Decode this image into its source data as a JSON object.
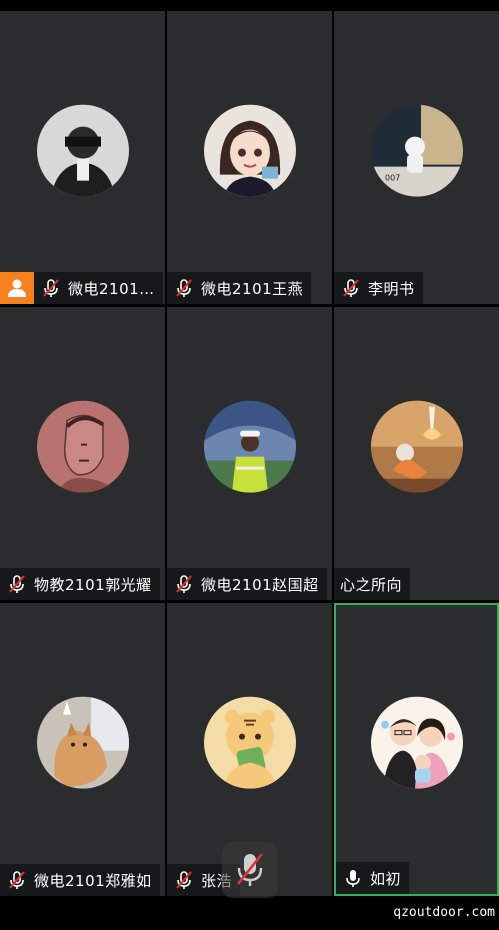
{
  "participants": [
    {
      "name": "微电2101…",
      "mic": "muted",
      "host": true,
      "avatar": "avatar-icon-person-camera",
      "color": "#cfcfcf"
    },
    {
      "name": "微电2101王燕",
      "mic": "muted",
      "host": false,
      "avatar": "avatar-icon-anime-girl",
      "color": "#e8dcd0"
    },
    {
      "name": "李明书",
      "mic": "muted",
      "host": false,
      "avatar": "avatar-icon-astronaut-figure",
      "color": "#2a3b4a"
    },
    {
      "name": "物教2101郭光耀",
      "mic": "muted",
      "host": false,
      "avatar": "avatar-icon-sketch-portrait",
      "color": "#b37370"
    },
    {
      "name": "微电2101赵国超",
      "mic": "muted",
      "host": false,
      "avatar": "avatar-icon-stadium-worker",
      "color": "#3f5b8a"
    },
    {
      "name": "心之所向",
      "mic": "none",
      "host": false,
      "avatar": "avatar-icon-astronaut-rocket",
      "color": "#c48a4a"
    },
    {
      "name": "微电2101郑雅如",
      "mic": "muted",
      "host": false,
      "avatar": "avatar-icon-cat",
      "color": "#d9b48a"
    },
    {
      "name": "张浩",
      "mic": "muted",
      "host": false,
      "avatar": "avatar-icon-tiger-cartoon",
      "color": "#f1d6a0"
    },
    {
      "name": "如初",
      "mic": "on",
      "host": false,
      "active": true,
      "avatar": "avatar-icon-family-cartoon",
      "color": "#f5d0c0"
    }
  ],
  "watermark": "qzoutdoor.com",
  "colors": {
    "tile": "#2b2c2e",
    "host_badge": "#f6821f",
    "active_border": "#2fb35a",
    "muted_red": "#e03131"
  }
}
